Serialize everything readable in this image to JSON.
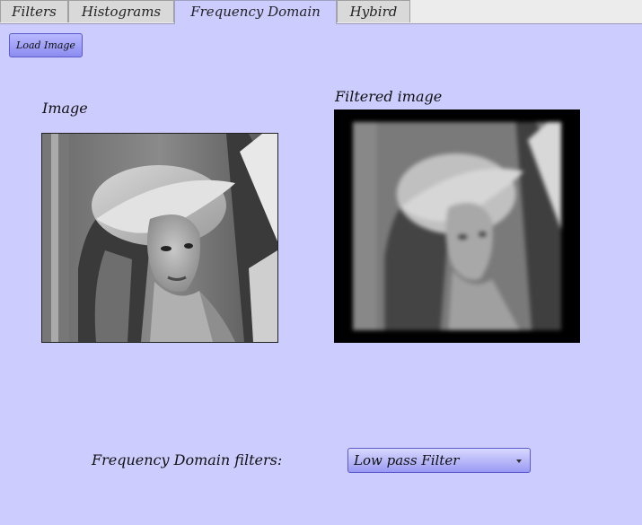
{
  "tabs": [
    {
      "label": "Filters",
      "active": false
    },
    {
      "label": "Histograms",
      "active": false
    },
    {
      "label": "Frequency Domain",
      "active": true
    },
    {
      "label": "Hybird",
      "active": false
    }
  ],
  "toolbar": {
    "load_image_label": "Load Image"
  },
  "panels": {
    "image_label": "Image",
    "filtered_label": "Filtered image"
  },
  "controls": {
    "filters_label": "Frequency Domain filters:",
    "filter_selected": "Low pass Filter"
  },
  "colors": {
    "background": "#ccccff",
    "button_accent": "#9a9af4"
  }
}
